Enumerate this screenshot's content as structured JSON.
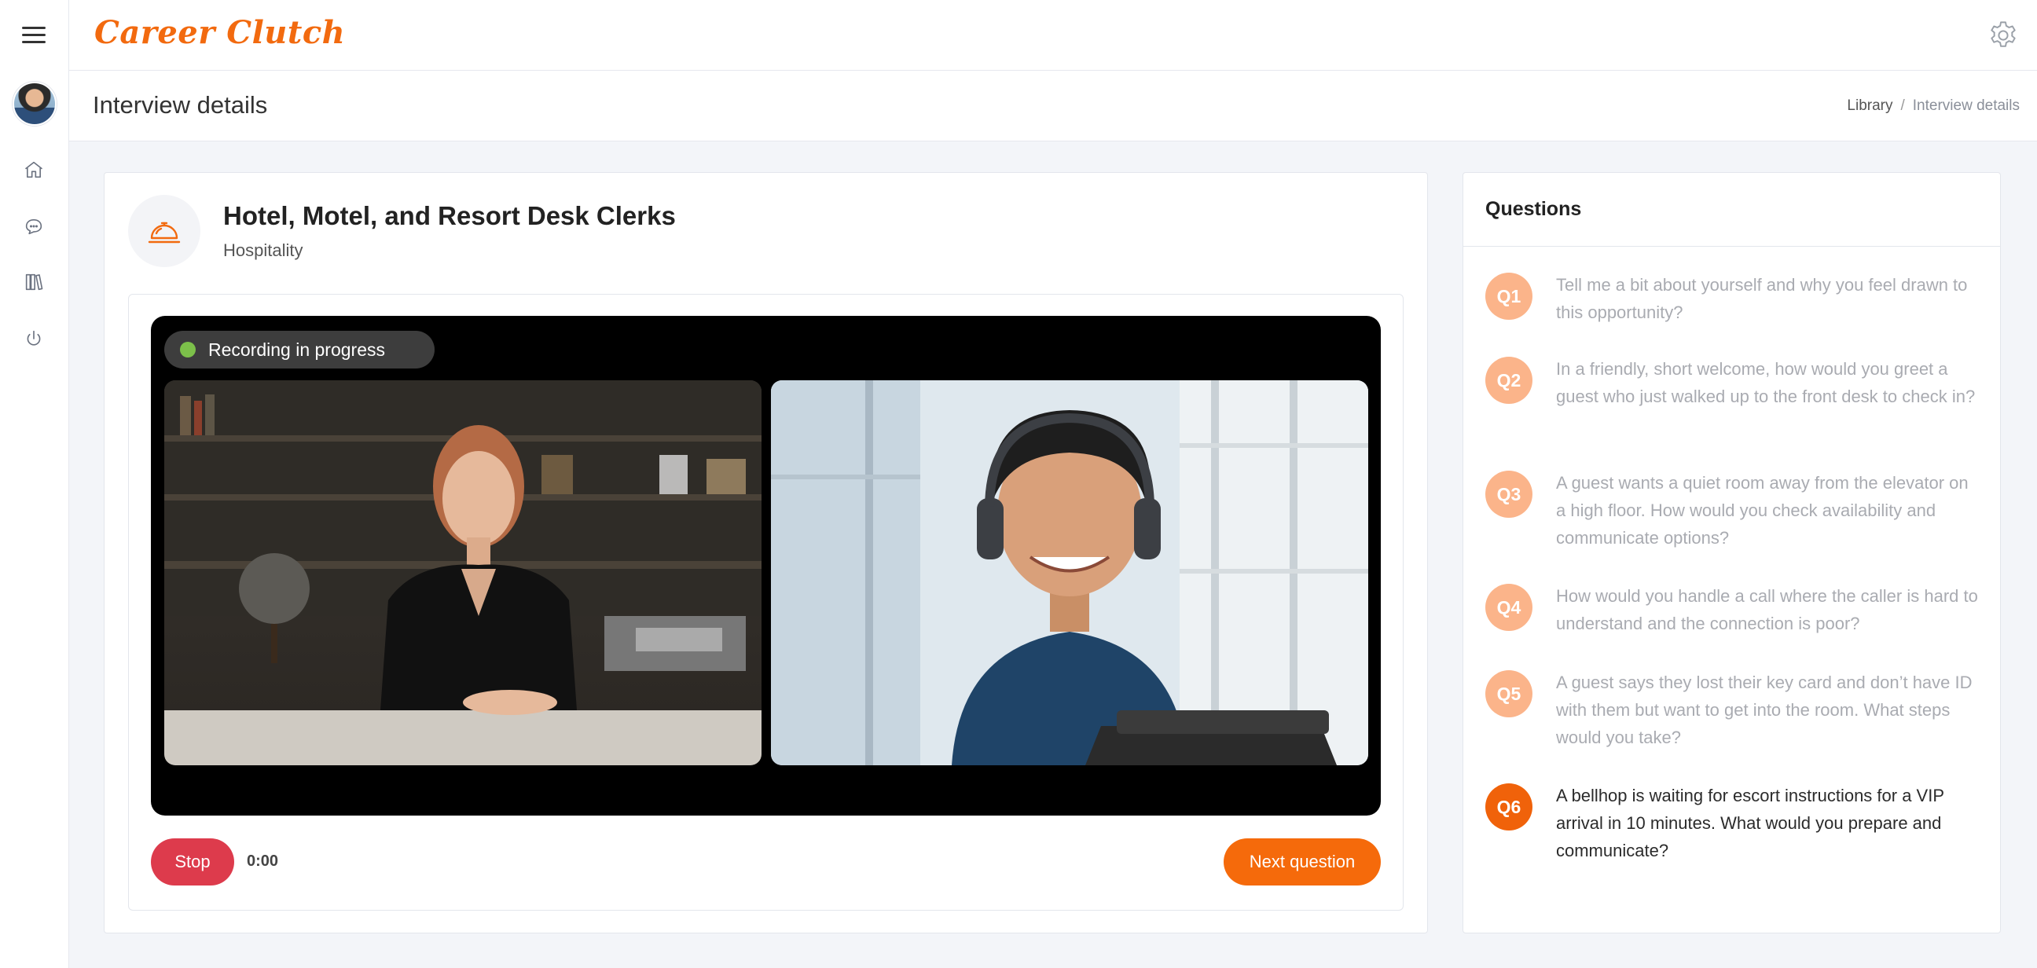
{
  "app": {
    "brand": "Career Clutch"
  },
  "header": {
    "page_title": "Interview details",
    "breadcrumb": {
      "parent": "Library",
      "separator": "/",
      "current": "Interview details"
    }
  },
  "sidebar": {
    "items": [
      {
        "name": "home",
        "icon": "home-icon"
      },
      {
        "name": "chat",
        "icon": "chat-icon"
      },
      {
        "name": "library",
        "icon": "library-icon"
      },
      {
        "name": "logout",
        "icon": "power-icon"
      }
    ]
  },
  "job": {
    "title": "Hotel, Motel, and Resort Desk Clerks",
    "category": "Hospitality",
    "icon": "service-bell-icon"
  },
  "recording": {
    "status": "Recording in progress",
    "timer": "0:00"
  },
  "controls": {
    "stop_label": "Stop",
    "next_label": "Next question"
  },
  "questions": {
    "heading": "Questions",
    "items": [
      {
        "badge": "Q1",
        "text": "Tell me a bit about yourself and why you feel drawn to this opportunity?",
        "active": false
      },
      {
        "badge": "Q2",
        "text": "In a friendly, short welcome, how would you greet a guest who just walked up to the front desk to check in?",
        "active": false
      },
      {
        "badge": "Q3",
        "text": "A guest wants a quiet room away from the elevator on a high floor. How would you check availability and communicate options?",
        "active": false
      },
      {
        "badge": "Q4",
        "text": "How would you handle a call where the caller is hard to understand and the connection is poor?",
        "active": false
      },
      {
        "badge": "Q5",
        "text": "A guest says they lost their key card and don’t have ID with them but want to get into the room. What steps would you take?",
        "active": false
      },
      {
        "badge": "Q6",
        "text": "A bellhop is waiting for escort instructions for a VIP arrival in 10 minutes. What would you prepare and communicate?",
        "active": true
      }
    ]
  },
  "colors": {
    "accent": "#f56a0b",
    "stop": "#dd3b4c",
    "recording_dot": "#7cc04a",
    "badge_inactive": "#fbb48a"
  }
}
